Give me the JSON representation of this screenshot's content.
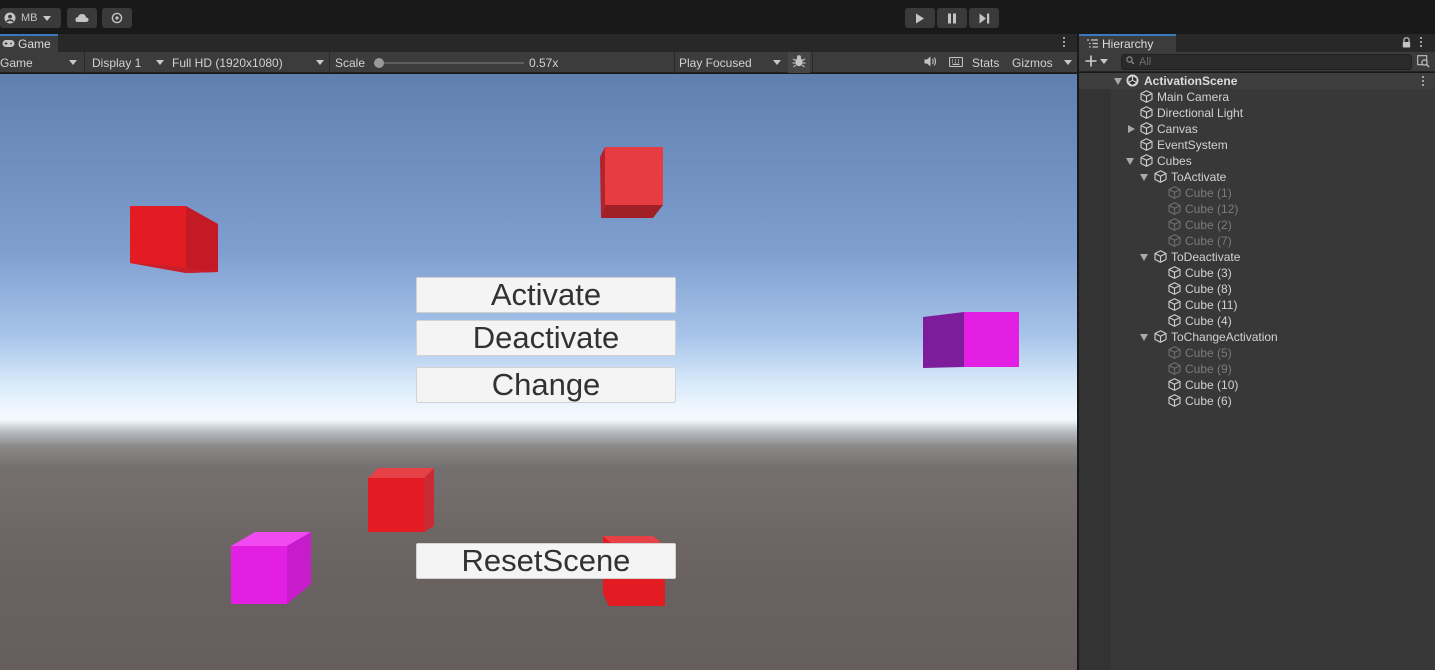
{
  "topbar": {
    "account_label": "MB"
  },
  "game": {
    "tab_label": "Game",
    "view_select": "Game",
    "display_select": "Display 1",
    "resolution_select": "Full HD (1920x1080)",
    "scale_label": "Scale",
    "scale_value_text": "0.57x",
    "scale_fraction": 0.0,
    "play_mode_select": "Play Focused",
    "stats_label": "Stats",
    "gizmos_label": "Gizmos",
    "buttons": {
      "activate": "Activate",
      "deactivate": "Deactivate",
      "change": "Change",
      "reset": "ResetScene"
    },
    "colors": {
      "cube_red": "#e31c24",
      "cube_magenta": "#e41fe4",
      "cube_purple": "#7e1d9b",
      "button_bg": "#f4f4f4"
    }
  },
  "hierarchy": {
    "tab_label": "Hierarchy",
    "search_placeholder": "All",
    "scene_name": "ActivationScene",
    "items": [
      {
        "label": "Main Camera",
        "depth": 1,
        "active": true,
        "foldout": "none"
      },
      {
        "label": "Directional Light",
        "depth": 1,
        "active": true,
        "foldout": "none"
      },
      {
        "label": "Canvas",
        "depth": 1,
        "active": true,
        "foldout": "closed"
      },
      {
        "label": "EventSystem",
        "depth": 1,
        "active": true,
        "foldout": "none"
      },
      {
        "label": "Cubes",
        "depth": 1,
        "active": true,
        "foldout": "open"
      },
      {
        "label": "ToActivate",
        "depth": 2,
        "active": true,
        "foldout": "open"
      },
      {
        "label": "Cube (1)",
        "depth": 3,
        "active": false,
        "foldout": "none"
      },
      {
        "label": "Cube (12)",
        "depth": 3,
        "active": false,
        "foldout": "none"
      },
      {
        "label": "Cube (2)",
        "depth": 3,
        "active": false,
        "foldout": "none"
      },
      {
        "label": "Cube (7)",
        "depth": 3,
        "active": false,
        "foldout": "none"
      },
      {
        "label": "ToDeactivate",
        "depth": 2,
        "active": true,
        "foldout": "open"
      },
      {
        "label": "Cube (3)",
        "depth": 3,
        "active": true,
        "foldout": "none"
      },
      {
        "label": "Cube (8)",
        "depth": 3,
        "active": true,
        "foldout": "none"
      },
      {
        "label": "Cube (11)",
        "depth": 3,
        "active": true,
        "foldout": "none"
      },
      {
        "label": "Cube (4)",
        "depth": 3,
        "active": true,
        "foldout": "none"
      },
      {
        "label": "ToChangeActivation",
        "depth": 2,
        "active": true,
        "foldout": "open"
      },
      {
        "label": "Cube (5)",
        "depth": 3,
        "active": false,
        "foldout": "none"
      },
      {
        "label": "Cube (9)",
        "depth": 3,
        "active": false,
        "foldout": "none"
      },
      {
        "label": "Cube (10)",
        "depth": 3,
        "active": true,
        "foldout": "none"
      },
      {
        "label": "Cube (6)",
        "depth": 3,
        "active": true,
        "foldout": "none"
      }
    ]
  }
}
